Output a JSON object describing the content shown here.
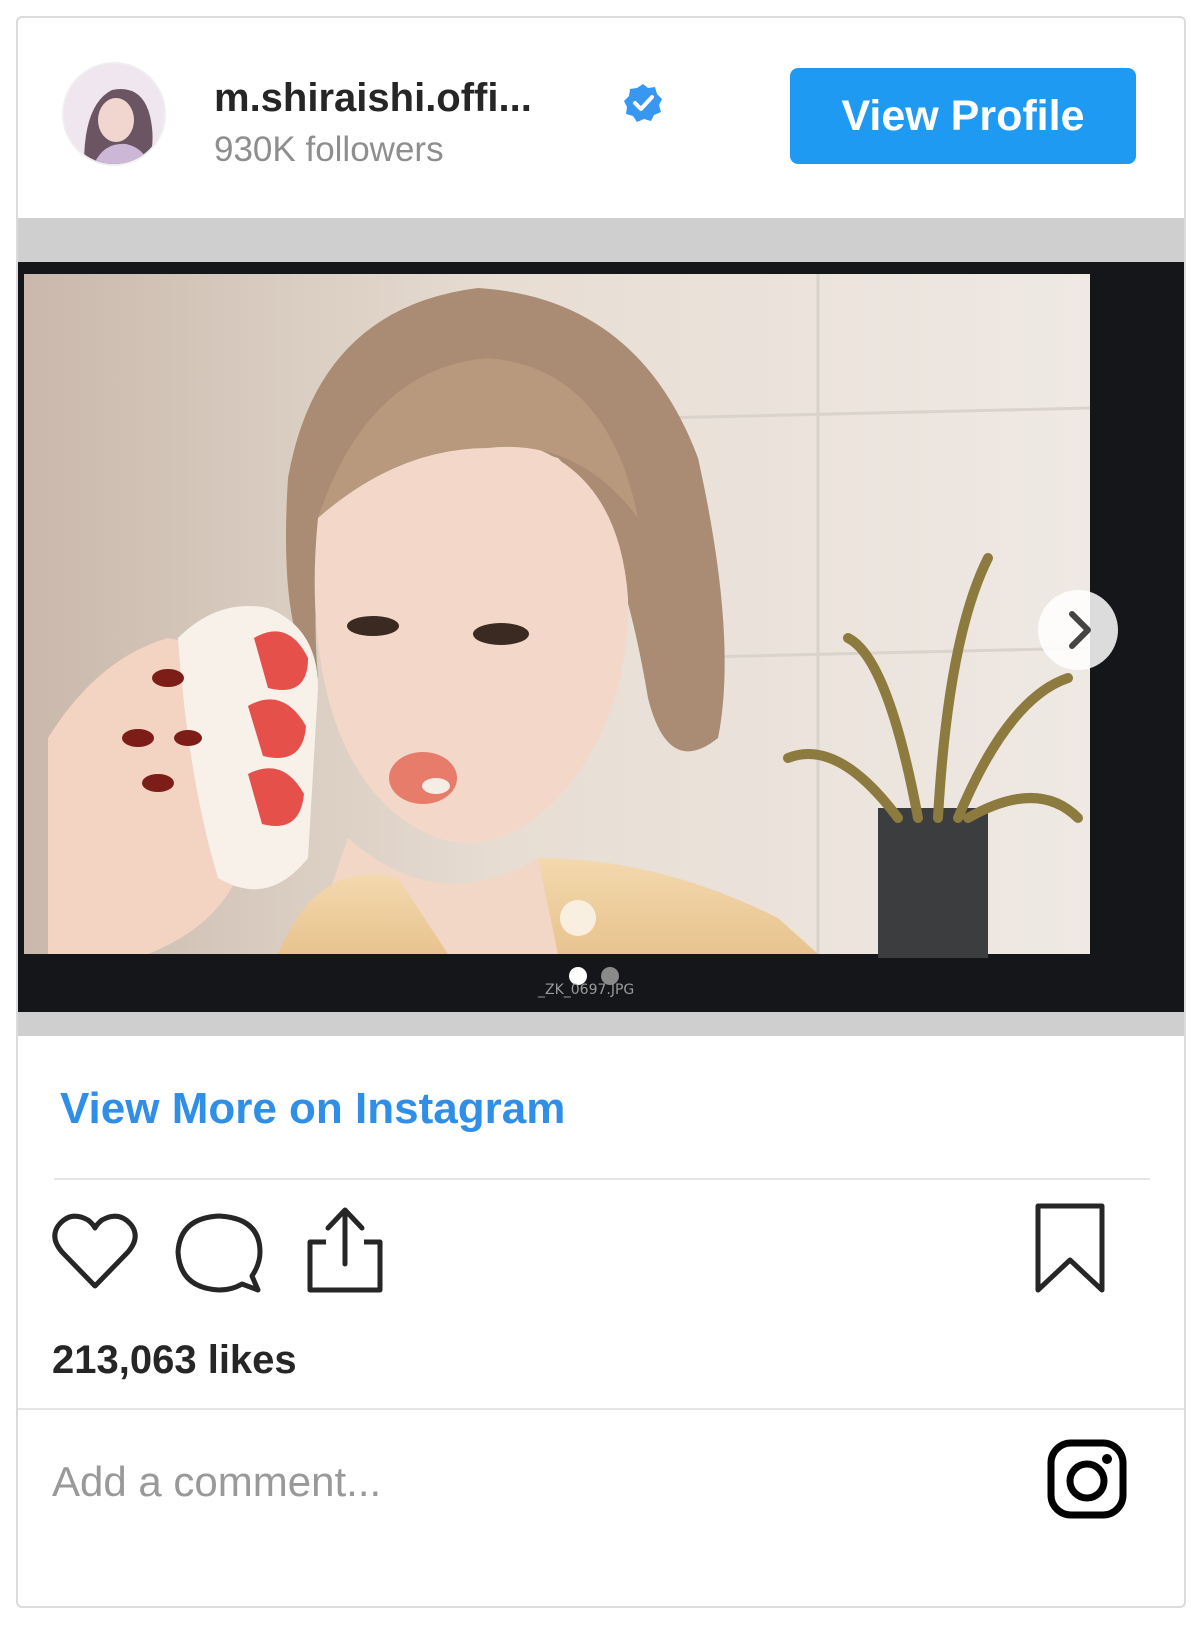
{
  "header": {
    "username": "m.shiraishi.offi...",
    "followers": "930K followers",
    "view_profile_label": "View Profile"
  },
  "media": {
    "image_caption": "_ZK_0697.JPG",
    "carousel": {
      "current": 1,
      "total": 2
    }
  },
  "links": {
    "view_more": "View More on Instagram"
  },
  "stats": {
    "likes": "213,063 likes"
  },
  "comment": {
    "placeholder": "Add a comment..."
  },
  "icons": {
    "verified": "verified-badge-icon",
    "like": "heart-icon",
    "comment": "comment-icon",
    "share": "share-icon",
    "save": "bookmark-icon",
    "instagram": "instagram-logo-icon",
    "next": "chevron-right-icon"
  },
  "colors": {
    "accent": "#1e9af2",
    "link": "#2f8ee8",
    "muted": "#8e8e8e"
  }
}
